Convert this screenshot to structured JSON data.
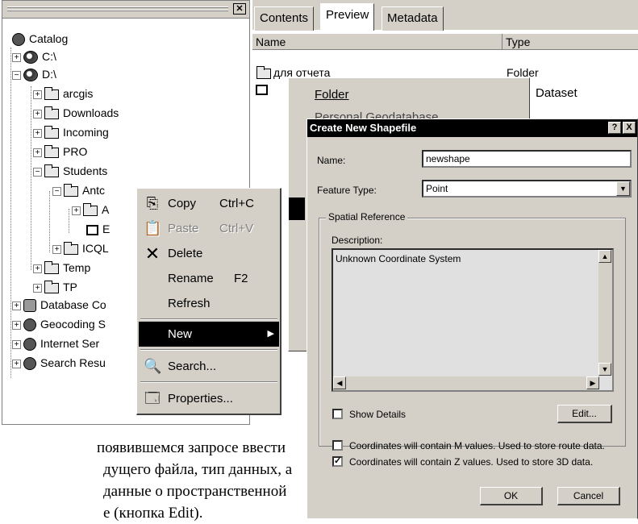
{
  "catalog": {
    "tree": [
      {
        "label": "Catalog",
        "icon": "catalog-icon"
      },
      {
        "label": "C:\\",
        "icon": "disk-icon",
        "expander": "+"
      },
      {
        "label": "D:\\",
        "icon": "disk-icon",
        "expander": "−"
      },
      {
        "label": "arcgis",
        "icon": "folder-icon",
        "expander": "+"
      },
      {
        "label": "Downloads",
        "icon": "folder-icon",
        "expander": "+"
      },
      {
        "label": "Incoming",
        "icon": "folder-icon",
        "expander": "+"
      },
      {
        "label": "PRO",
        "icon": "folder-icon",
        "expander": "+"
      },
      {
        "label": "Students",
        "icon": "folder-icon",
        "expander": "−"
      },
      {
        "label": "Antc",
        "icon": "open-folder-icon",
        "expander": "−"
      },
      {
        "label": "A",
        "icon": "folder-icon",
        "expander": "+"
      },
      {
        "label": "E",
        "icon": "shapefile-icon"
      },
      {
        "label": "ICQL",
        "icon": "folder-icon",
        "expander": "+"
      },
      {
        "label": "Temp",
        "icon": "folder-icon",
        "expander": "+"
      },
      {
        "label": "TP",
        "icon": "folder-icon",
        "expander": "+"
      },
      {
        "label": "Database Co",
        "icon": "database-icon",
        "expander": "+"
      },
      {
        "label": "Geocoding S",
        "icon": "globe-icon",
        "expander": "+"
      },
      {
        "label": "Internet Ser",
        "icon": "internet-icon",
        "expander": "+"
      },
      {
        "label": "Search Resu",
        "icon": "search-results-icon",
        "expander": "+"
      }
    ]
  },
  "contents": {
    "tabs": [
      "Contents",
      "Preview",
      "Metadata"
    ],
    "columns": [
      "Name",
      "Type"
    ],
    "rows": [
      {
        "name": "для отчета",
        "type": "Folder"
      },
      {
        "name": "",
        "type": ""
      }
    ]
  },
  "new_submenu": {
    "items": [
      {
        "label": "Folder",
        "type": "Dataset"
      },
      {
        "label": "Personal Geodatabase"
      }
    ]
  },
  "context_menu": {
    "items": [
      {
        "label": "Copy",
        "shortcut": "Ctrl+C",
        "icon": "copy-icon"
      },
      {
        "label": "Paste",
        "shortcut": "Ctrl+V",
        "icon": "paste-icon",
        "disabled": true
      },
      {
        "label": "Delete",
        "shortcut": "",
        "icon": "delete-icon"
      },
      {
        "label": "Rename",
        "shortcut": "F2",
        "icon": ""
      },
      {
        "label": "Refresh",
        "shortcut": "",
        "icon": ""
      },
      {
        "label": "New",
        "shortcut": "",
        "icon": "",
        "submenu": true
      },
      {
        "label": "Search...",
        "shortcut": "",
        "icon": "search-icon"
      },
      {
        "label": "Properties...",
        "shortcut": "",
        "icon": "properties-icon"
      }
    ]
  },
  "dialog": {
    "title": "Create New Shapefile",
    "help_btn": "?",
    "close_btn": "X",
    "name_label": "Name:",
    "name_value": "newshape",
    "feature_type_label": "Feature Type:",
    "feature_type_value": "Point",
    "spatial_reference_label": "Spatial Reference",
    "description_label": "Description:",
    "description_value": "Unknown Coordinate System",
    "show_details_label": "Show Details",
    "show_details_checked": false,
    "edit_button": "Edit...",
    "m_values_label": "Coordinates will contain M values. Used to store route data.",
    "m_values_checked": false,
    "z_values_label": "Coordinates will contain Z values. Used to store 3D data.",
    "z_values_checked": true,
    "ok_button": "OK",
    "cancel_button": "Cancel"
  },
  "doc_text": {
    "line1": "появившемся запросе ввести",
    "line2": "дущего файла, тип данных, а",
    "line3": "данные о пространственной",
    "line4": "е (кнопка Edit)."
  }
}
